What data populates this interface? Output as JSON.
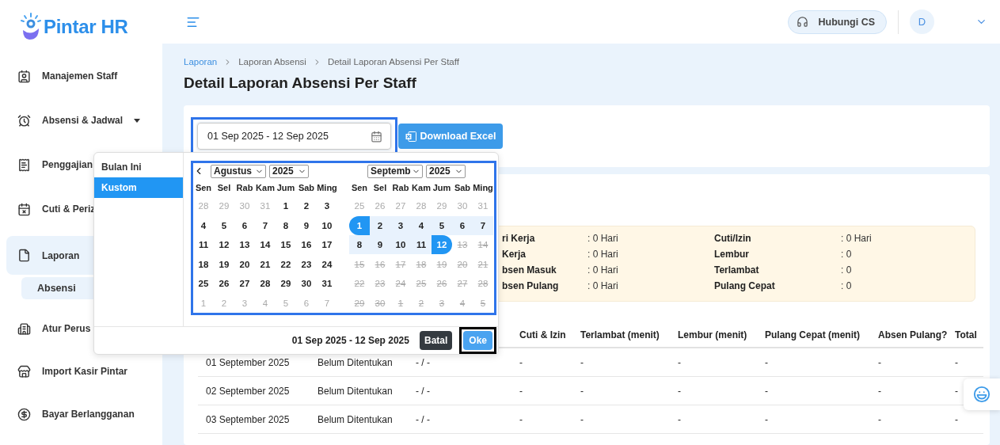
{
  "logo": {
    "text": "Pintar HR"
  },
  "sidebar": {
    "items": [
      {
        "label": "Manajemen Staff",
        "selected": false,
        "dropdown": false
      },
      {
        "label": "Absensi & Jadwal",
        "selected": false,
        "dropdown": true
      },
      {
        "label": "Penggajian",
        "selected": false,
        "dropdown": false
      },
      {
        "label": "Cuti & Periz",
        "selected": false,
        "dropdown": false
      },
      {
        "label": "Laporan",
        "selected": true,
        "dropdown": false,
        "children": [
          {
            "label": "Absensi",
            "selected": true
          }
        ]
      },
      {
        "label": "Atur Perus",
        "selected": false,
        "dropdown": false
      },
      {
        "label": "Import Kasir Pintar",
        "selected": false,
        "dropdown": false
      },
      {
        "label": "Bayar Berlangganan",
        "selected": false,
        "dropdown": false
      }
    ]
  },
  "header": {
    "contact_button": "Hubungi CS",
    "avatar": "D"
  },
  "breadcrumb": [
    "Laporan",
    "Laporan Absensi",
    "Detail Laporan Absensi Per Staff"
  ],
  "title": "Detail Laporan Absensi Per Staff",
  "date_range_field": {
    "value": "01 Sep 2025 - 12 Sep 2025"
  },
  "download_button": "Download Excel",
  "date_picker": {
    "presets": [
      {
        "label": "Bulan Ini",
        "selected": false
      },
      {
        "label": "Kustom",
        "selected": true
      }
    ],
    "calendars": [
      {
        "month": "Agustus",
        "year": "2025",
        "prev": true,
        "weekdays": [
          "Sen",
          "Sel",
          "Rab",
          "Kam",
          "Jum",
          "Sab",
          "Ming"
        ],
        "weeks": [
          [
            {
              "d": "28",
              "kind": "outside"
            },
            {
              "d": "29",
              "kind": "outside"
            },
            {
              "d": "30",
              "kind": "outside"
            },
            {
              "d": "31",
              "kind": "outside"
            },
            {
              "d": "1",
              "kind": "day"
            },
            {
              "d": "2",
              "kind": "day"
            },
            {
              "d": "3",
              "kind": "day"
            }
          ],
          [
            {
              "d": "4",
              "kind": "day"
            },
            {
              "d": "5",
              "kind": "day"
            },
            {
              "d": "6",
              "kind": "day"
            },
            {
              "d": "7",
              "kind": "day"
            },
            {
              "d": "8",
              "kind": "day"
            },
            {
              "d": "9",
              "kind": "day"
            },
            {
              "d": "10",
              "kind": "day"
            }
          ],
          [
            {
              "d": "11",
              "kind": "day"
            },
            {
              "d": "12",
              "kind": "day"
            },
            {
              "d": "13",
              "kind": "day"
            },
            {
              "d": "14",
              "kind": "day"
            },
            {
              "d": "15",
              "kind": "day"
            },
            {
              "d": "16",
              "kind": "day"
            },
            {
              "d": "17",
              "kind": "day"
            }
          ],
          [
            {
              "d": "18",
              "kind": "day"
            },
            {
              "d": "19",
              "kind": "day"
            },
            {
              "d": "20",
              "kind": "day"
            },
            {
              "d": "21",
              "kind": "day"
            },
            {
              "d": "22",
              "kind": "day"
            },
            {
              "d": "23",
              "kind": "day"
            },
            {
              "d": "24",
              "kind": "day"
            }
          ],
          [
            {
              "d": "25",
              "kind": "day"
            },
            {
              "d": "26",
              "kind": "day"
            },
            {
              "d": "27",
              "kind": "day"
            },
            {
              "d": "28",
              "kind": "day"
            },
            {
              "d": "29",
              "kind": "day"
            },
            {
              "d": "30",
              "kind": "day"
            },
            {
              "d": "31",
              "kind": "day"
            }
          ],
          [
            {
              "d": "1",
              "kind": "outside"
            },
            {
              "d": "2",
              "kind": "outside"
            },
            {
              "d": "3",
              "kind": "outside"
            },
            {
              "d": "4",
              "kind": "outside"
            },
            {
              "d": "5",
              "kind": "outside"
            },
            {
              "d": "6",
              "kind": "outside"
            },
            {
              "d": "7",
              "kind": "outside"
            }
          ]
        ]
      },
      {
        "month": "Septemb",
        "year": "2025",
        "prev": false,
        "weekdays": [
          "Sen",
          "Sel",
          "Rab",
          "Kam",
          "Jum",
          "Sab",
          "Ming"
        ],
        "weeks": [
          [
            {
              "d": "25",
              "kind": "outside"
            },
            {
              "d": "26",
              "kind": "outside"
            },
            {
              "d": "27",
              "kind": "outside"
            },
            {
              "d": "28",
              "kind": "outside"
            },
            {
              "d": "29",
              "kind": "outside"
            },
            {
              "d": "30",
              "kind": "outside"
            },
            {
              "d": "31",
              "kind": "outside"
            }
          ],
          [
            {
              "d": "1",
              "kind": "start"
            },
            {
              "d": "2",
              "kind": "range"
            },
            {
              "d": "3",
              "kind": "range"
            },
            {
              "d": "4",
              "kind": "range"
            },
            {
              "d": "5",
              "kind": "range"
            },
            {
              "d": "6",
              "kind": "range"
            },
            {
              "d": "7",
              "kind": "range"
            }
          ],
          [
            {
              "d": "8",
              "kind": "range"
            },
            {
              "d": "9",
              "kind": "range"
            },
            {
              "d": "10",
              "kind": "range"
            },
            {
              "d": "11",
              "kind": "range"
            },
            {
              "d": "12",
              "kind": "end"
            },
            {
              "d": "13",
              "kind": "disabled"
            },
            {
              "d": "14",
              "kind": "disabled"
            }
          ],
          [
            {
              "d": "15",
              "kind": "disabled"
            },
            {
              "d": "16",
              "kind": "disabled"
            },
            {
              "d": "17",
              "kind": "disabled"
            },
            {
              "d": "18",
              "kind": "disabled"
            },
            {
              "d": "19",
              "kind": "disabled"
            },
            {
              "d": "20",
              "kind": "disabled"
            },
            {
              "d": "21",
              "kind": "disabled"
            }
          ],
          [
            {
              "d": "22",
              "kind": "disabled"
            },
            {
              "d": "23",
              "kind": "disabled"
            },
            {
              "d": "24",
              "kind": "disabled"
            },
            {
              "d": "25",
              "kind": "disabled"
            },
            {
              "d": "26",
              "kind": "disabled"
            },
            {
              "d": "27",
              "kind": "disabled"
            },
            {
              "d": "28",
              "kind": "disabled"
            }
          ],
          [
            {
              "d": "29",
              "kind": "disabled"
            },
            {
              "d": "30",
              "kind": "disabled"
            },
            {
              "d": "1",
              "kind": "disabled"
            },
            {
              "d": "2",
              "kind": "disabled"
            },
            {
              "d": "3",
              "kind": "disabled"
            },
            {
              "d": "4",
              "kind": "disabled"
            },
            {
              "d": "5",
              "kind": "disabled"
            }
          ]
        ]
      }
    ],
    "footer_range": "01 Sep 2025 - 12 Sep 2025",
    "cancel_button": "Batal",
    "ok_button": "Oke"
  },
  "summary": {
    "left": [
      {
        "label": "ri Kerja",
        "value": ": 0 Hari"
      },
      {
        "label": "Kerja",
        "value": ": 0 Hari"
      },
      {
        "label": "bsen Masuk",
        "value": ": 0 Hari"
      },
      {
        "label": "bsen Pulang",
        "value": ": 0 Hari"
      }
    ],
    "right": [
      {
        "label": "Cuti/Izin",
        "value": ": 0 Hari"
      },
      {
        "label": "Lembur",
        "value": ": 0"
      },
      {
        "label": "Terlambat",
        "value": ": 0"
      },
      {
        "label": "Pulang Cepat",
        "value": ": 0"
      }
    ]
  },
  "table": {
    "columns": [
      "",
      "",
      "",
      "Cuti & Izin",
      "Terlambat (menit)",
      "Lembur (menit)",
      "Pulang Cepat (menit)",
      "Absen Pulang?",
      "Total"
    ],
    "rows": [
      [
        "01 September 2025",
        "Belum Ditentukan",
        "- / -",
        "-",
        "-",
        "-",
        "-",
        "-",
        "-"
      ],
      [
        "02 September 2025",
        "Belum Ditentukan",
        "- / -",
        "-",
        "-",
        "-",
        "-",
        "-",
        "-"
      ],
      [
        "03 September 2025",
        "Belum Ditentukan",
        "- / -",
        "-",
        "-",
        "-",
        "-",
        "-",
        "-"
      ]
    ]
  }
}
